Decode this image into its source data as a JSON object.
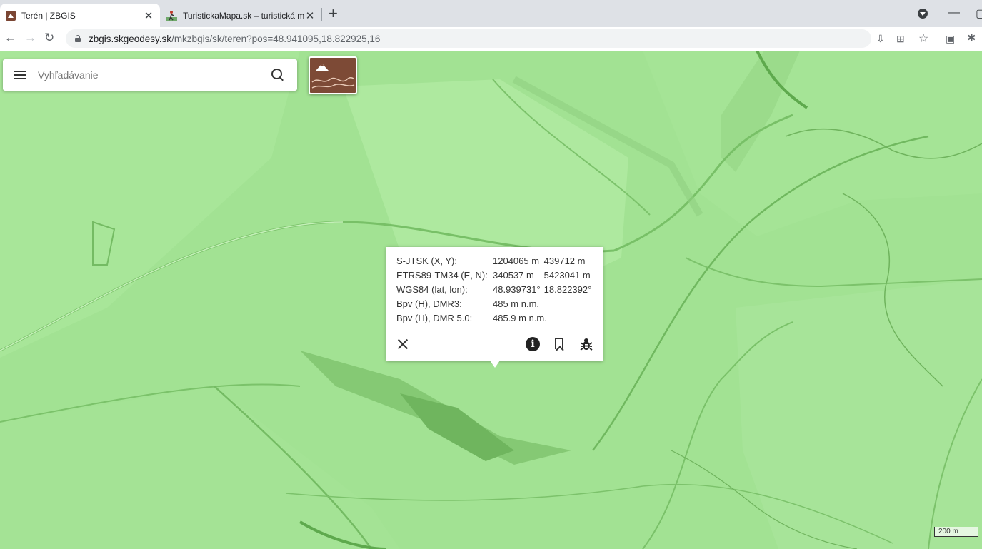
{
  "browser": {
    "tabs": [
      {
        "title": "Terén | ZBGIS",
        "active": true,
        "icon": "terrain-favicon"
      },
      {
        "title": "TuristickaMapa.sk – turistická ma",
        "active": false,
        "icon": "hiker-favicon"
      }
    ],
    "url_host": "zbgis.skgeodesy.sk",
    "url_path": "/mkzbgis/sk/teren?pos=48.941095,18.822925,16"
  },
  "search": {
    "placeholder": "Vyhľadávanie"
  },
  "popup": {
    "rows": [
      {
        "label": "S-JTSK (X, Y):",
        "v1": "1204065 m",
        "v2": "439712 m"
      },
      {
        "label": "ETRS89-TM34 (E, N):",
        "v1": "340537 m",
        "v2": "5423041 m"
      },
      {
        "label": "WGS84 (lat, lon):",
        "v1": "48.939731°",
        "v2": "18.822392°"
      },
      {
        "label": "Bpv (H), DMR3:",
        "v1": "485 m n.m.",
        "v2": ""
      },
      {
        "label": "Bpv (H), DMR 5.0:",
        "v1": "485.9 m n.m.",
        "v2": ""
      }
    ],
    "info_glyph": "i"
  },
  "scale": {
    "label": "200 m"
  },
  "colors": {
    "map_base": "#9ee08f",
    "layer_thumb": "#7d4a36"
  }
}
